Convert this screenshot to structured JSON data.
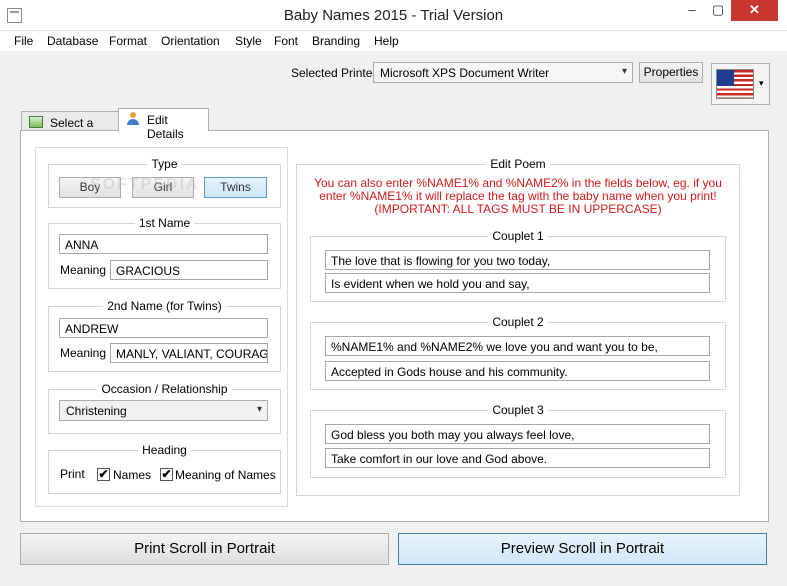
{
  "window": {
    "title": "Baby Names 2015 - Trial Version",
    "min": "–",
    "max": "▢",
    "close": "✕"
  },
  "menu": [
    "File",
    "Database",
    "Format",
    "Orientation",
    "Style",
    "Font",
    "Branding",
    "Help"
  ],
  "printer": {
    "label": "Selected Printer",
    "value": "Microsoft XPS Document Writer",
    "properties": "Properties"
  },
  "tabs": {
    "select_style": "Select a Style",
    "edit_details": "Edit Details"
  },
  "type": {
    "legend": "Type",
    "options": [
      "Boy",
      "Girl",
      "Twins"
    ],
    "selected": "Twins"
  },
  "name1": {
    "legend": "1st Name",
    "name": "ANNA",
    "meaning_label": "Meaning",
    "meaning": "GRACIOUS"
  },
  "name2": {
    "legend": "2nd Name (for Twins)",
    "name": "ANDREW",
    "meaning_label": "Meaning",
    "meaning": "MANLY, VALIANT, COURAGEOUS"
  },
  "occasion": {
    "legend": "Occasion / Relationship",
    "value": "Christening"
  },
  "heading": {
    "legend": "Heading",
    "print_label": "Print",
    "names": "Names",
    "meaning_names": "Meaning of Names"
  },
  "poem": {
    "legend": "Edit Poem",
    "note1": "You can also enter %NAME1% and %NAME2% in the fields below, eg. if you",
    "note2": "enter %NAME1% it will replace the tag with the baby name when you print!",
    "note3": "(IMPORTANT: ALL TAGS MUST BE IN UPPERCASE)",
    "couplets": [
      {
        "title": "Couplet 1",
        "line1": "The love that is flowing for you two today,",
        "line2": "Is evident when we hold you and say,"
      },
      {
        "title": "Couplet 2",
        "line1": "%NAME1% and %NAME2% we love you and want you to be,",
        "line2": "Accepted in Gods house and his community."
      },
      {
        "title": "Couplet 3",
        "line1": "God bless you both may you always feel love,",
        "line2": "Take comfort in our love and God above."
      }
    ]
  },
  "actions": {
    "print": "Print Scroll in Portrait",
    "preview": "Preview Scroll in Portrait"
  },
  "watermark": "SOFTPEDIA",
  "icons": {
    "check": "✔",
    "dropdown": "▾",
    "flag_arrow": "▾"
  }
}
